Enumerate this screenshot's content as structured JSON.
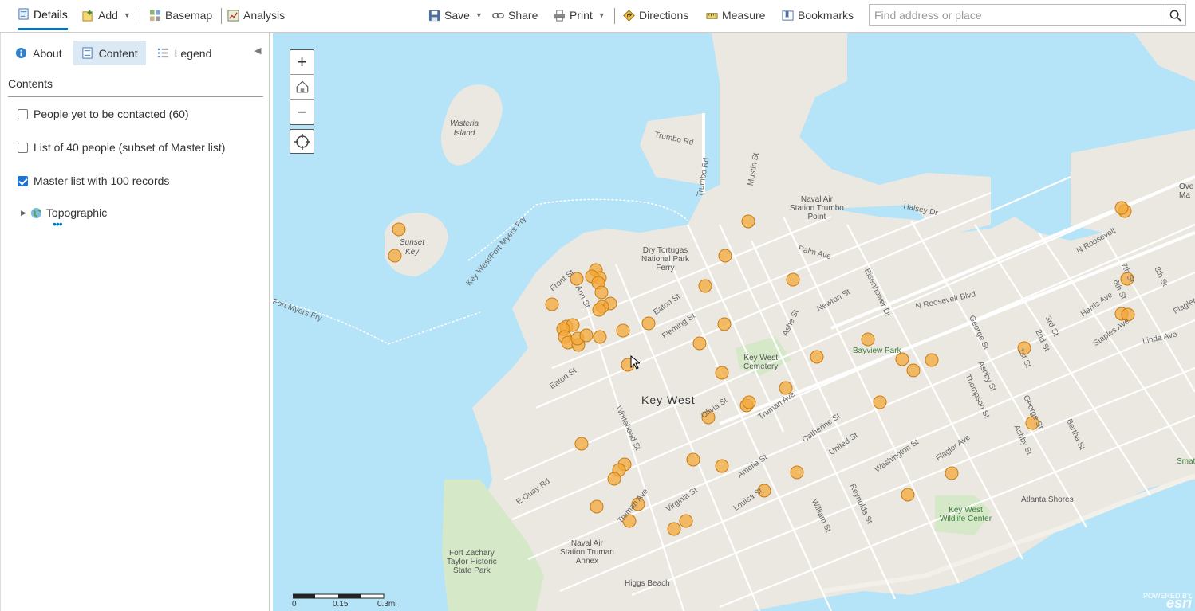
{
  "toolbar": {
    "details": "Details",
    "add": "Add",
    "basemap": "Basemap",
    "analysis": "Analysis",
    "save": "Save",
    "share": "Share",
    "print": "Print",
    "directions": "Directions",
    "measure": "Measure",
    "bookmarks": "Bookmarks",
    "search_placeholder": "Find address or place"
  },
  "panel": {
    "tabs": [
      {
        "label": "About",
        "active": false
      },
      {
        "label": "Content",
        "active": true
      },
      {
        "label": "Legend",
        "active": false
      }
    ],
    "contents_heading": "Contents",
    "layers": [
      {
        "label": "People yet to be contacted (60)",
        "checked": false
      },
      {
        "label": "List of 40 people (subset of Master list)",
        "checked": false
      },
      {
        "label": "Master list with 100 records",
        "checked": true
      }
    ],
    "basemap_layer": "Topographic",
    "more": "•••"
  },
  "map": {
    "city_label": "Key West",
    "places": {
      "wisteria": "Wisteria\nIsland",
      "sunset": "Sunset\nKey",
      "trumbo_point": "Naval Air\nStation Trumbo\nPoint",
      "dry_tortugas": "Dry Tortugas\nNational Park\nFerry",
      "cemetery": "Key West\nCemetery",
      "bayview": "Bayview Park",
      "fort_zachary": "Fort Zachary\nTaylor Historic\nState Park",
      "truman_annex": "Naval Air\nStation Truman\nAnnex",
      "higgs": "Higgs Beach",
      "wildlife": "Key West\nWildlife Center",
      "atlanta": "Atlanta Shores",
      "ove": "Ove\nMa",
      "smat": "Smat"
    },
    "streets": {
      "trumbo_rd": "Trumbo Rd",
      "trumbo_rd2": "Trumbo Rd",
      "mustin": "Mustin St",
      "halsey": "Halsey Dr",
      "palm": "Palm Ave",
      "newton": "Newton St",
      "eisenhower": "Eisenhower Dr",
      "nroosevelt": "N Roosevelt Blvd",
      "nroosevelt2": "N Roosevelt",
      "harris": "Harris Ave",
      "staples": "Staples Ave",
      "linda": "Linda Ave",
      "flagler2": "Flagler",
      "seventh": "7th St",
      "eighth": "8th St",
      "sixth": "6th St",
      "third": "3rd St",
      "second": "2nd St",
      "first": "1st St",
      "george": "George St",
      "george2": "George St",
      "ashby": "Ashby St",
      "ashby2": "Ashby St",
      "thompson": "Thompson St",
      "bertha": "Bertha St",
      "flagler": "Flagler Ave",
      "washington": "Washington St",
      "reynolds": "Reynolds St",
      "william": "William St",
      "united": "United St",
      "catherine": "Catherine St",
      "amelia": "Amelia St",
      "louisa": "Louisa St",
      "virginia": "Virginia St",
      "truman": "Truman Ave",
      "truman2": "Truman Ave",
      "olivia": "Olivia St",
      "ashe": "Ashe St",
      "whitehead": "Whitehead St",
      "eaton": "Eaton St",
      "eaton2": "Eaton St",
      "fleming": "Fleming St",
      "front": "Front St",
      "ann": "Ann St",
      "equay": "E Quay Rd",
      "kwfmf": "Key West/Fort Myers Fry",
      "fmf": "Fort Myers Fry"
    },
    "scale": {
      "l0": "0",
      "l1": "0.15",
      "l2": "0.3mi"
    },
    "attribution": {
      "top": "POWERED BY",
      "brand": "esri"
    },
    "colors": {
      "water": "#b5e3f7",
      "land": "#ebe8e1",
      "park": "#d5e8c8",
      "point_fill": "#f4a93a",
      "point_stroke": "#c77b12",
      "accent": "#0079c1"
    }
  }
}
